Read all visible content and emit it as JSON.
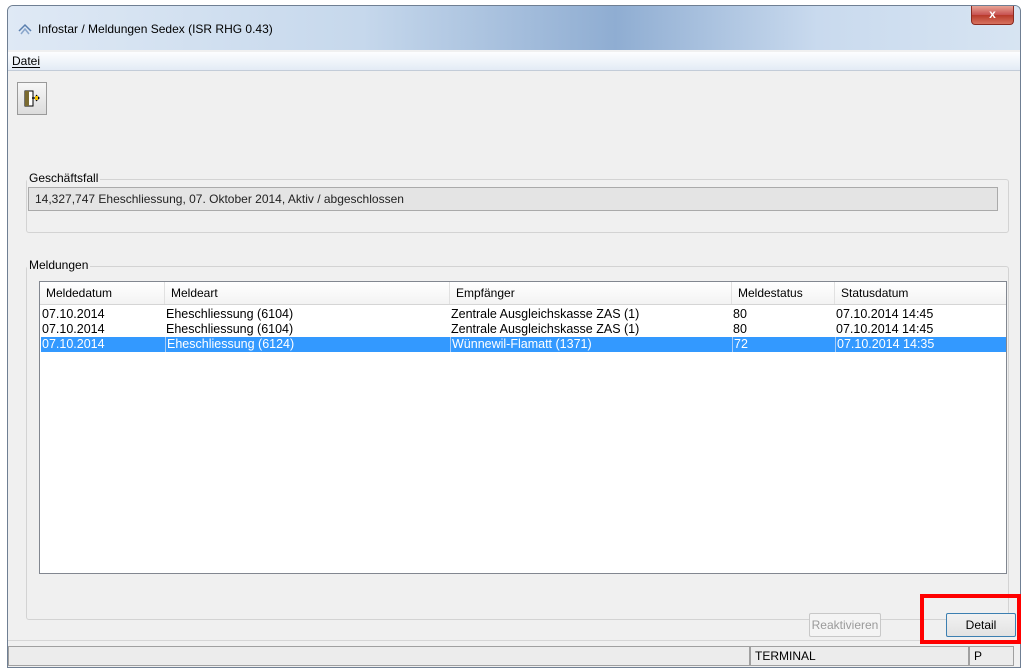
{
  "window": {
    "title": "Infostar / Meldungen Sedex (ISR RHG 0.43)",
    "close_glyph": "x"
  },
  "menu": {
    "datei": "Datei"
  },
  "toolbar": {
    "exit_icon": "exit-door-icon"
  },
  "geschaeftsfall": {
    "legend": "Geschäftsfall",
    "value": "14,327,747  Eheschliessung, 07. Oktober 2014, Aktiv / abgeschlossen"
  },
  "meldungen": {
    "legend": "Meldungen",
    "columns": [
      "Meldedatum",
      "Meldeart",
      "Empfänger",
      "Meldestatus",
      "Statusdatum"
    ],
    "rows": [
      {
        "meldedatum": "07.10.2014",
        "meldeart": "Eheschliessung (6104)",
        "empfaenger": "Zentrale Ausgleichskasse ZAS (1)",
        "meldestatus": "80",
        "statusdatum": "07.10.2014 14:45"
      },
      {
        "meldedatum": "07.10.2014",
        "meldeart": "Eheschliessung (6104)",
        "empfaenger": "Zentrale Ausgleichskasse ZAS (1)",
        "meldestatus": "80",
        "statusdatum": "07.10.2014 14:45"
      },
      {
        "meldedatum": "07.10.2014",
        "meldeart": "Eheschliessung (6124)",
        "empfaenger": "Wünnewil-Flamatt (1371)",
        "meldestatus": "72",
        "statusdatum": "07.10.2014 14:35"
      }
    ],
    "selected_row_index": 2
  },
  "buttons": {
    "reaktivieren": "Reaktivieren",
    "detail": "Detail"
  },
  "statusbar": {
    "terminal": "TERMINAL",
    "mode": "P"
  },
  "colors": {
    "selection": "#3399ff",
    "highlight": "#ff0000"
  }
}
